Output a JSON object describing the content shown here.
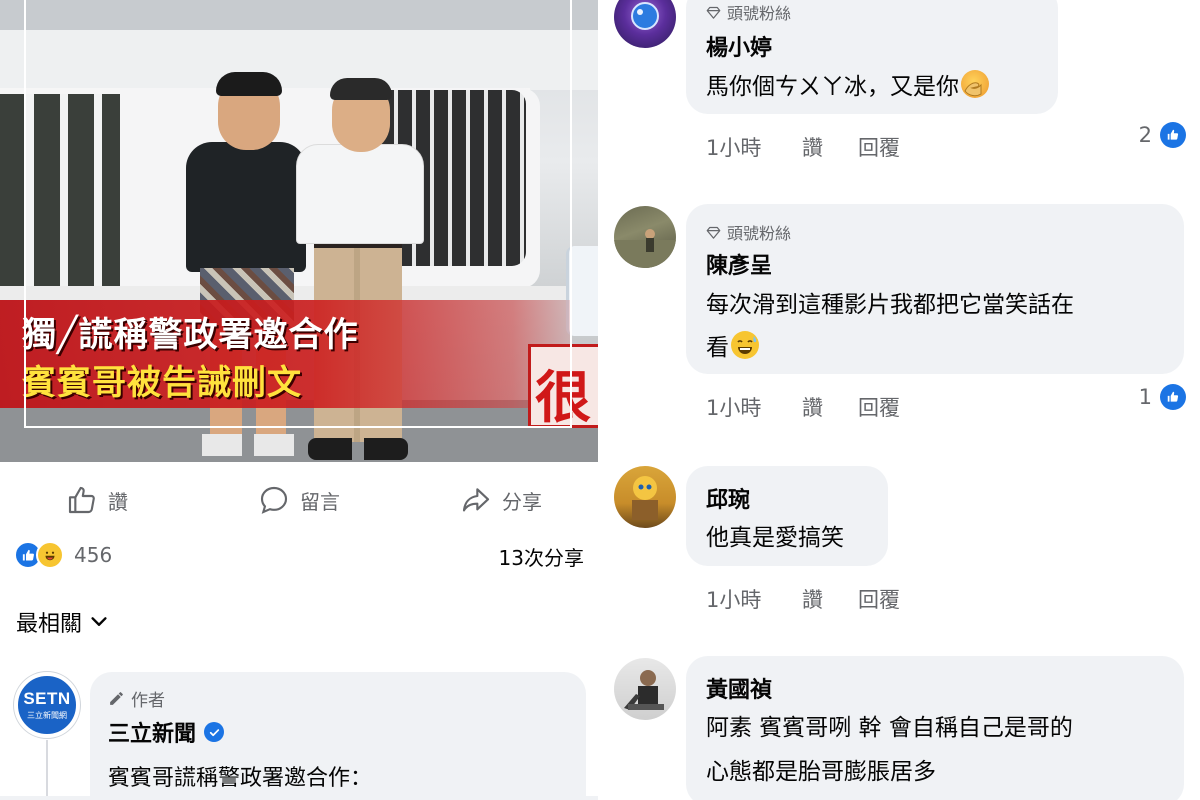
{
  "post": {
    "banner_line1": "獨╱謊稱警政署邀合作",
    "banner_line2": "賓賓哥被告誡刪文",
    "stamp_char": "很",
    "actions": {
      "like": "讚",
      "comment": "留言",
      "share": "分享"
    },
    "reaction_count": "456",
    "share_count": "13次分享",
    "sort_label": "最相關",
    "author": {
      "logo_main": "SETN",
      "logo_sub": "三立新聞網",
      "tag": "作者",
      "name": "三立新聞",
      "text": "賓賓哥謊稱警政署邀合作："
    }
  },
  "comments": [
    {
      "badge": "頭號粉絲",
      "name": "楊小婷",
      "lines": [
        "馬你個ㄘㄨㄚ冰，又是你"
      ],
      "time": "1小時",
      "like": "讚",
      "reply": "回覆",
      "reactions": "2"
    },
    {
      "badge": "頭號粉絲",
      "name": "陳彥呈",
      "lines": [
        "每次滑到這種影片我都把它當笑話在",
        "看"
      ],
      "time": "1小時",
      "like": "讚",
      "reply": "回覆",
      "reactions": "1"
    },
    {
      "name": "邱琬",
      "lines": [
        "他真是愛搞笑"
      ],
      "time": "1小時",
      "like": "讚",
      "reply": "回覆"
    },
    {
      "name": "黃國禎",
      "lines": [
        "阿素 賓賓哥咧 幹 會自稱自己是哥的",
        "心態都是胎哥膨脹居多"
      ]
    }
  ],
  "colors": {
    "facebook_blue": "#1b74e4",
    "bubble_bg": "#f0f2f5",
    "secondary_text": "#65676b",
    "banner_red": "#c8141a",
    "banner_yellow": "#ffe23d"
  },
  "icons": [
    "like-icon",
    "comment-icon",
    "share-icon",
    "chevron-down-icon",
    "pencil-icon",
    "verified-icon",
    "diamond-icon",
    "facepalm-emoji",
    "sweat-smile-emoji"
  ]
}
